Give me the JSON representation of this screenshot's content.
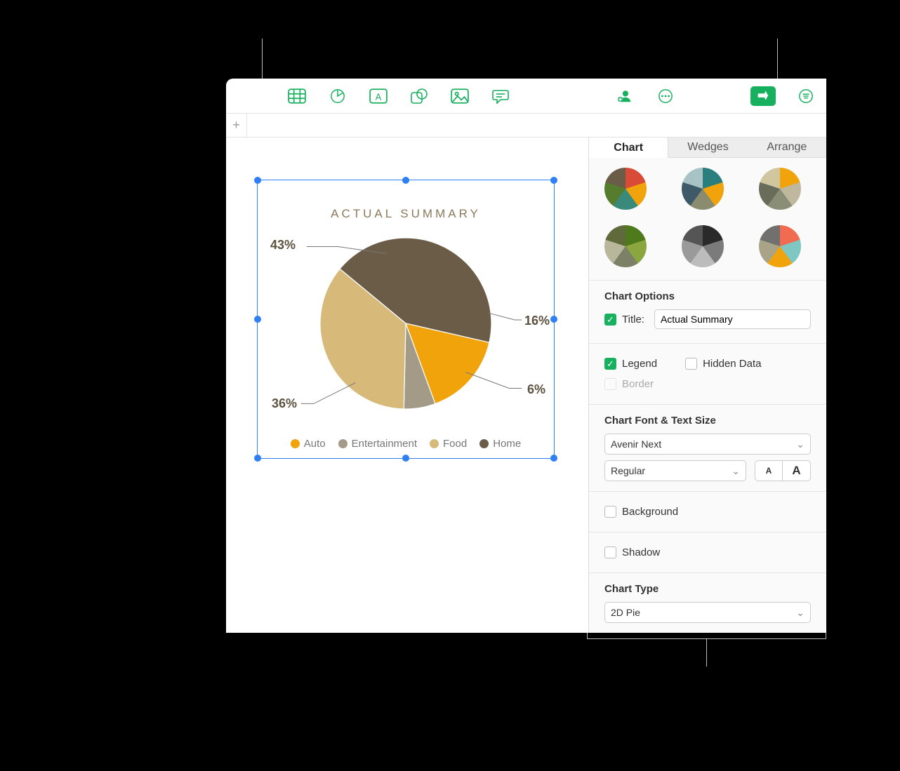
{
  "chart_data": {
    "type": "pie",
    "title": "ACTUAL SUMMARY",
    "series": [
      {
        "name": "Home",
        "value": 43,
        "color": "#6b5c48"
      },
      {
        "name": "Auto",
        "value": 16,
        "color": "#f0a30a"
      },
      {
        "name": "Entertainment",
        "value": 6,
        "color": "#a39a87"
      },
      {
        "name": "Food",
        "value": 36,
        "color": "#d7b97a"
      }
    ],
    "legend_order": [
      "Auto",
      "Entertainment",
      "Food",
      "Home"
    ],
    "value_suffix": "%"
  },
  "toolbar": {
    "icons": [
      "table",
      "chart",
      "text",
      "shape",
      "media",
      "comment",
      "collaborate",
      "more",
      "format",
      "organize"
    ]
  },
  "sidebar": {
    "tabs": {
      "chart": "Chart",
      "wedges": "Wedges",
      "arrange": "Arrange"
    },
    "styles": [
      [
        "#d94b36",
        "#f0a30a",
        "#3a8a7b",
        "#567d2e",
        "#6b5c48"
      ],
      [
        "#2b7e7e",
        "#f0a30a",
        "#8a8b6f",
        "#3e5a68",
        "#a8c3c6"
      ],
      [
        "#f0a30a",
        "#bfb89f",
        "#8b8e77",
        "#6a6c5a",
        "#d0c7a0"
      ],
      [
        "#4e7a1c",
        "#8ba63f",
        "#7b8067",
        "#b8b79b",
        "#5e6a3a"
      ],
      [
        "#2a2a2a",
        "#7b7b7b",
        "#bcbcbc",
        "#9a9a9a",
        "#555555"
      ],
      [
        "#f06b4f",
        "#7fc7c2",
        "#f0a30a",
        "#a9a488",
        "#70706e"
      ]
    ],
    "chart_options": {
      "header": "Chart Options",
      "title_label": "Title:",
      "title_checked": true,
      "title_value": "Actual Summary",
      "legend_label": "Legend",
      "legend_checked": true,
      "hidden_label": "Hidden Data",
      "hidden_checked": false,
      "border_label": "Border",
      "border_checked": false,
      "border_disabled": true
    },
    "font": {
      "header": "Chart Font & Text Size",
      "family": "Avenir Next",
      "weight": "Regular",
      "small_glyph": "A",
      "large_glyph": "A"
    },
    "background": {
      "label": "Background",
      "checked": false
    },
    "shadow": {
      "label": "Shadow",
      "checked": false
    },
    "chart_type": {
      "header": "Chart Type",
      "value": "2D Pie"
    }
  }
}
